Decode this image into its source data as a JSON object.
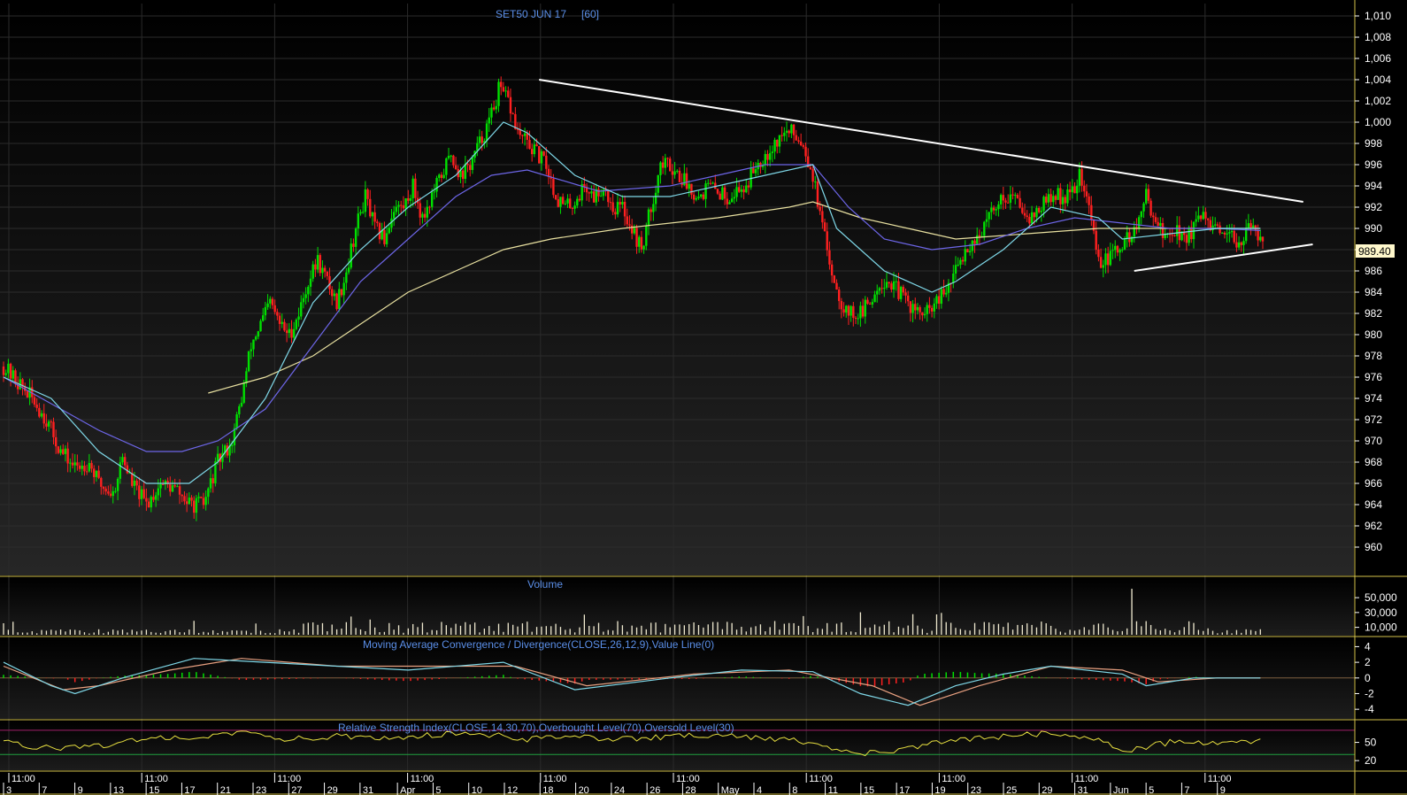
{
  "chart_data": [
    {
      "type": "candlestick",
      "title": "SET50 JUN 17",
      "subtitle": "[60]",
      "ylim": [
        958,
        1011
      ],
      "yticks": [
        "1,010",
        "1,008",
        "1,006",
        "1,004",
        "1,002",
        "1,000",
        "998",
        "996",
        "994",
        "992",
        "990",
        "988",
        "986",
        "984",
        "982",
        "980",
        "978",
        "976",
        "974",
        "972",
        "970",
        "968",
        "966",
        "964",
        "962",
        "960"
      ],
      "last_price": "989.40",
      "grid": true,
      "colors": {
        "up": "#00e000",
        "down": "#ff2020",
        "ma_fast": "#7fd8e8",
        "ma_mid": "#6d66e8",
        "ma_slow": "#e8e0a0",
        "trendline": "#ffffff",
        "text": "#5b8fe8"
      },
      "close_path": [
        [
          0,
          977
        ],
        [
          6,
          975.5
        ],
        [
          12,
          974
        ],
        [
          18,
          972
        ],
        [
          24,
          969
        ],
        [
          30,
          967.5
        ],
        [
          36,
          968
        ],
        [
          40,
          966
        ],
        [
          46,
          965
        ],
        [
          50,
          968.5
        ],
        [
          54,
          966
        ],
        [
          60,
          964
        ],
        [
          66,
          966
        ],
        [
          72,
          965.5
        ],
        [
          78,
          964
        ],
        [
          84,
          964
        ],
        [
          90,
          968
        ],
        [
          96,
          970
        ],
        [
          100,
          974
        ],
        [
          104,
          979
        ],
        [
          108,
          981
        ],
        [
          112,
          983
        ],
        [
          116,
          981
        ],
        [
          120,
          980
        ],
        [
          124,
          982
        ],
        [
          128,
          985
        ],
        [
          132,
          987
        ],
        [
          136,
          985
        ],
        [
          140,
          983
        ],
        [
          144,
          986
        ],
        [
          148,
          990
        ],
        [
          152,
          993
        ],
        [
          156,
          990
        ],
        [
          160,
          989
        ],
        [
          164,
          992
        ],
        [
          168,
          992
        ],
        [
          172,
          994
        ],
        [
          176,
          991
        ],
        [
          180,
          993
        ],
        [
          184,
          995
        ],
        [
          188,
          997
        ],
        [
          192,
          995
        ],
        [
          196,
          996
        ],
        [
          200,
          998
        ],
        [
          204,
          1000
        ],
        [
          208,
          1003
        ],
        [
          212,
          1002
        ],
        [
          216,
          999
        ],
        [
          220,
          998
        ],
        [
          224,
          997
        ],
        [
          228,
          996
        ],
        [
          232,
          993
        ],
        [
          236,
          992
        ],
        [
          240,
          992.5
        ],
        [
          244,
          994
        ],
        [
          248,
          993
        ],
        [
          252,
          994
        ],
        [
          256,
          992
        ],
        [
          260,
          992
        ],
        [
          264,
          990
        ],
        [
          268,
          988
        ],
        [
          272,
          992
        ],
        [
          276,
          996
        ],
        [
          280,
          996
        ],
        [
          284,
          995
        ],
        [
          288,
          994
        ],
        [
          292,
          993
        ],
        [
          296,
          994
        ],
        [
          300,
          993.5
        ],
        [
          304,
          993
        ],
        [
          308,
          993.5
        ],
        [
          312,
          994
        ],
        [
          316,
          996
        ],
        [
          320,
          997
        ],
        [
          324,
          998
        ],
        [
          328,
          999
        ],
        [
          332,
          999
        ],
        [
          336,
          998
        ],
        [
          340,
          995
        ],
        [
          344,
          990
        ],
        [
          348,
          986
        ],
        [
          352,
          983
        ],
        [
          356,
          982
        ],
        [
          360,
          982
        ],
        [
          364,
          983
        ],
        [
          368,
          985
        ],
        [
          372,
          985
        ],
        [
          376,
          984
        ],
        [
          380,
          983
        ],
        [
          384,
          982
        ],
        [
          388,
          982
        ],
        [
          392,
          983
        ],
        [
          396,
          984
        ],
        [
          400,
          986
        ],
        [
          404,
          988
        ],
        [
          408,
          989
        ],
        [
          412,
          990
        ],
        [
          416,
          992
        ],
        [
          420,
          993
        ],
        [
          424,
          993
        ],
        [
          428,
          992
        ],
        [
          432,
          991
        ],
        [
          436,
          992
        ],
        [
          440,
          993
        ],
        [
          444,
          993
        ],
        [
          448,
          993
        ],
        [
          452,
          995
        ],
        [
          456,
          992
        ],
        [
          460,
          987
        ],
        [
          464,
          987
        ],
        [
          468,
          988
        ],
        [
          472,
          989
        ],
        [
          476,
          990
        ],
        [
          480,
          993
        ],
        [
          484,
          991
        ],
        [
          488,
          989
        ],
        [
          492,
          990
        ],
        [
          496,
          989
        ],
        [
          500,
          990
        ],
        [
          504,
          991
        ],
        [
          508,
          990
        ],
        [
          512,
          989
        ],
        [
          516,
          989
        ],
        [
          520,
          989
        ],
        [
          524,
          990
        ],
        [
          528,
          989.4
        ]
      ],
      "ma_fast": [
        [
          0,
          976
        ],
        [
          20,
          974
        ],
        [
          40,
          969
        ],
        [
          60,
          966
        ],
        [
          78,
          966
        ],
        [
          90,
          968
        ],
        [
          110,
          974
        ],
        [
          130,
          983
        ],
        [
          150,
          988
        ],
        [
          170,
          992
        ],
        [
          190,
          995
        ],
        [
          210,
          1000
        ],
        [
          220,
          999
        ],
        [
          240,
          995
        ],
        [
          260,
          993
        ],
        [
          280,
          993
        ],
        [
          300,
          994
        ],
        [
          320,
          995
        ],
        [
          340,
          996
        ],
        [
          350,
          990
        ],
        [
          370,
          986
        ],
        [
          390,
          984
        ],
        [
          400,
          985
        ],
        [
          420,
          988
        ],
        [
          440,
          992
        ],
        [
          460,
          991
        ],
        [
          470,
          989
        ],
        [
          490,
          989.5
        ],
        [
          510,
          990
        ],
        [
          528,
          990
        ]
      ],
      "ma_mid": [
        [
          0,
          976
        ],
        [
          20,
          973.5
        ],
        [
          40,
          971
        ],
        [
          60,
          969
        ],
        [
          75,
          969
        ],
        [
          90,
          970
        ],
        [
          110,
          973
        ],
        [
          130,
          979
        ],
        [
          150,
          985
        ],
        [
          170,
          989
        ],
        [
          190,
          993
        ],
        [
          205,
          995
        ],
        [
          220,
          995.5
        ],
        [
          250,
          993.5
        ],
        [
          280,
          994
        ],
        [
          300,
          995
        ],
        [
          320,
          996
        ],
        [
          340,
          996
        ],
        [
          355,
          992
        ],
        [
          370,
          989
        ],
        [
          390,
          988
        ],
        [
          410,
          988.5
        ],
        [
          430,
          990
        ],
        [
          450,
          991
        ],
        [
          470,
          990.5
        ],
        [
          490,
          990
        ],
        [
          510,
          990
        ],
        [
          528,
          989.8
        ]
      ],
      "ma_slow": [
        [
          86,
          974.5
        ],
        [
          110,
          976
        ],
        [
          130,
          978
        ],
        [
          150,
          981
        ],
        [
          170,
          984
        ],
        [
          190,
          986
        ],
        [
          210,
          988
        ],
        [
          230,
          989
        ],
        [
          260,
          990
        ],
        [
          300,
          991
        ],
        [
          330,
          992
        ],
        [
          340,
          992.5
        ],
        [
          360,
          991
        ],
        [
          380,
          990
        ],
        [
          400,
          989
        ],
        [
          430,
          989.5
        ],
        [
          460,
          990
        ],
        [
          490,
          990
        ],
        [
          528,
          990
        ]
      ],
      "trendlines": [
        {
          "from": [
            225,
            1004
          ],
          "to": [
            546,
            992.5
          ]
        },
        {
          "from": [
            475,
            986
          ],
          "to": [
            550,
            988.5
          ]
        }
      ]
    },
    {
      "type": "bar",
      "title": "Volume",
      "ylim": [
        0,
        68000
      ],
      "yticks": [
        "50,000",
        "30,000",
        "10,000"
      ],
      "spike": 62000
    },
    {
      "type": "line",
      "title": "Moving Average Convergence / Divergence(CLOSE,26,12,9),Value Line(0)",
      "ylim": [
        -5,
        4.5
      ],
      "yticks": [
        "4",
        "2",
        "0",
        "-2",
        "-4"
      ],
      "macd_path": [
        [
          0,
          2
        ],
        [
          20,
          -1
        ],
        [
          30,
          -2
        ],
        [
          50,
          0
        ],
        [
          80,
          2.5
        ],
        [
          110,
          2
        ],
        [
          140,
          1.5
        ],
        [
          170,
          1
        ],
        [
          210,
          2
        ],
        [
          240,
          -1.5
        ],
        [
          280,
          0
        ],
        [
          310,
          1
        ],
        [
          340,
          0.8
        ],
        [
          360,
          -2
        ],
        [
          380,
          -3.5
        ],
        [
          400,
          -1
        ],
        [
          420,
          0.5
        ],
        [
          440,
          1.5
        ],
        [
          470,
          0.5
        ],
        [
          480,
          -1
        ],
        [
          500,
          0
        ],
        [
          528,
          0
        ]
      ],
      "signal_path": [
        [
          0,
          1.5
        ],
        [
          25,
          -1.5
        ],
        [
          40,
          -1
        ],
        [
          70,
          1
        ],
        [
          100,
          2.5
        ],
        [
          140,
          1.5
        ],
        [
          180,
          1.5
        ],
        [
          215,
          1.5
        ],
        [
          245,
          -1
        ],
        [
          290,
          0.5
        ],
        [
          330,
          1
        ],
        [
          365,
          -1
        ],
        [
          385,
          -3.5
        ],
        [
          410,
          -1
        ],
        [
          440,
          1.5
        ],
        [
          470,
          1
        ],
        [
          485,
          -0.5
        ],
        [
          510,
          0
        ],
        [
          528,
          0
        ]
      ]
    },
    {
      "type": "line",
      "title": "Relative Strength Index(CLOSE,14,30,70),Overbought Level(70),Oversold Level(30)",
      "ylim": [
        10,
        80
      ],
      "yticks": [
        "50",
        "20"
      ],
      "levels": [
        70,
        30
      ],
      "rsi_path": [
        [
          0,
          50
        ],
        [
          20,
          40
        ],
        [
          40,
          45
        ],
        [
          60,
          55
        ],
        [
          80,
          60
        ],
        [
          100,
          65
        ],
        [
          120,
          55
        ],
        [
          140,
          60
        ],
        [
          160,
          58
        ],
        [
          180,
          62
        ],
        [
          200,
          65
        ],
        [
          220,
          55
        ],
        [
          240,
          60
        ],
        [
          260,
          55
        ],
        [
          280,
          60
        ],
        [
          300,
          62
        ],
        [
          320,
          58
        ],
        [
          340,
          50
        ],
        [
          360,
          30
        ],
        [
          380,
          40
        ],
        [
          400,
          55
        ],
        [
          420,
          60
        ],
        [
          440,
          65
        ],
        [
          460,
          55
        ],
        [
          470,
          35
        ],
        [
          490,
          50
        ],
        [
          510,
          48
        ],
        [
          528,
          52
        ]
      ]
    }
  ],
  "x_axis": {
    "ticks": [
      "3",
      "7",
      "9",
      "13",
      "15",
      "17",
      "21",
      "23",
      "27",
      "29",
      "31",
      "Apr",
      "5",
      "10",
      "12",
      "18",
      "20",
      "24",
      "26",
      "28",
      "May",
      "4",
      "8",
      "11",
      "15",
      "17",
      "19",
      "23",
      "25",
      "29",
      "31",
      "Jun",
      "5",
      "7",
      "9"
    ],
    "time_labels": [
      "11:00",
      "11:00",
      "11:00",
      "11:00",
      "11:00",
      "11:00",
      "11:00",
      "11:00",
      "11:00",
      "11:00"
    ]
  }
}
